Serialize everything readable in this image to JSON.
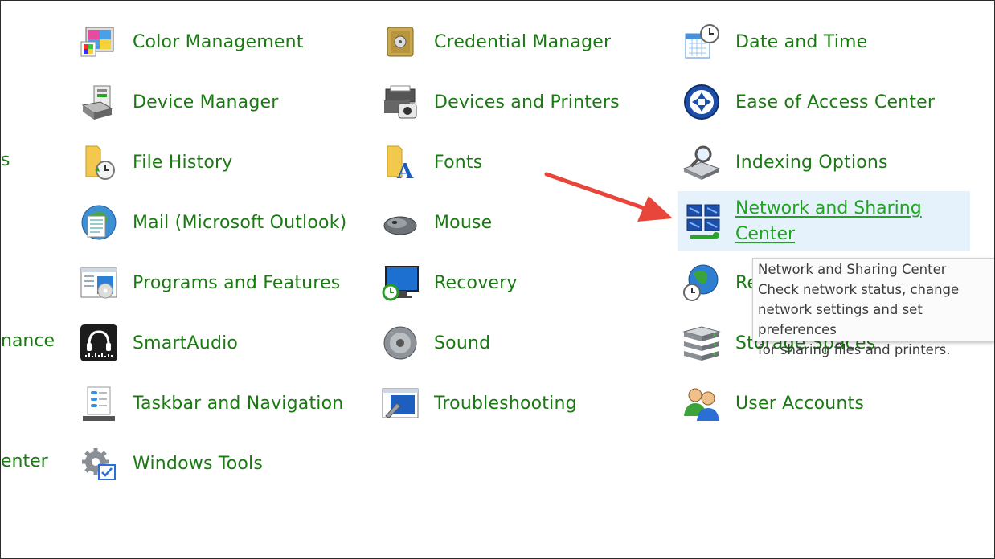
{
  "partial_left": [
    "s",
    "nance",
    "enter"
  ],
  "columns": {
    "col1": [
      {
        "label": "Color Management",
        "icon": "color-management-icon"
      },
      {
        "label": "Device Manager",
        "icon": "device-manager-icon"
      },
      {
        "label": "File History",
        "icon": "file-history-icon"
      },
      {
        "label": "Mail (Microsoft Outlook)",
        "icon": "mail-icon"
      },
      {
        "label": "Programs and Features",
        "icon": "programs-features-icon"
      },
      {
        "label": "SmartAudio",
        "icon": "smartaudio-icon"
      },
      {
        "label": "Taskbar and Navigation",
        "icon": "taskbar-icon"
      },
      {
        "label": "Windows Tools",
        "icon": "windows-tools-icon"
      }
    ],
    "col2": [
      {
        "label": "Credential Manager",
        "icon": "credential-manager-icon"
      },
      {
        "label": "Devices and Printers",
        "icon": "devices-printers-icon"
      },
      {
        "label": "Fonts",
        "icon": "fonts-icon"
      },
      {
        "label": "Mouse",
        "icon": "mouse-icon"
      },
      {
        "label": "Recovery",
        "icon": "recovery-icon"
      },
      {
        "label": "Sound",
        "icon": "sound-icon"
      },
      {
        "label": "Troubleshooting",
        "icon": "troubleshooting-icon"
      }
    ],
    "col3": [
      {
        "label": "Date and Time",
        "icon": "date-time-icon"
      },
      {
        "label": "Ease of Access Center",
        "icon": "ease-of-access-icon"
      },
      {
        "label": "Indexing Options",
        "icon": "indexing-icon"
      },
      {
        "label_line1": "Network and Sharing ",
        "label_line2": "Center",
        "icon": "network-sharing-icon",
        "hovered": true
      },
      {
        "label": "Re",
        "icon": "region-icon"
      },
      {
        "label": "Storage Spaces",
        "icon": "storage-spaces-icon"
      },
      {
        "label": "User Accounts",
        "icon": "user-accounts-icon"
      }
    ]
  },
  "tooltip": {
    "title": "Network and Sharing Center",
    "line1": "Check network status, change",
    "line2": "network settings and set preferences",
    "line3": "for sharing files and printers."
  },
  "colors": {
    "link_green": "#1a7a12",
    "hover_green": "#1ea51e",
    "hover_bg": "#e5f1fb",
    "arrow_red": "#e8463a"
  }
}
